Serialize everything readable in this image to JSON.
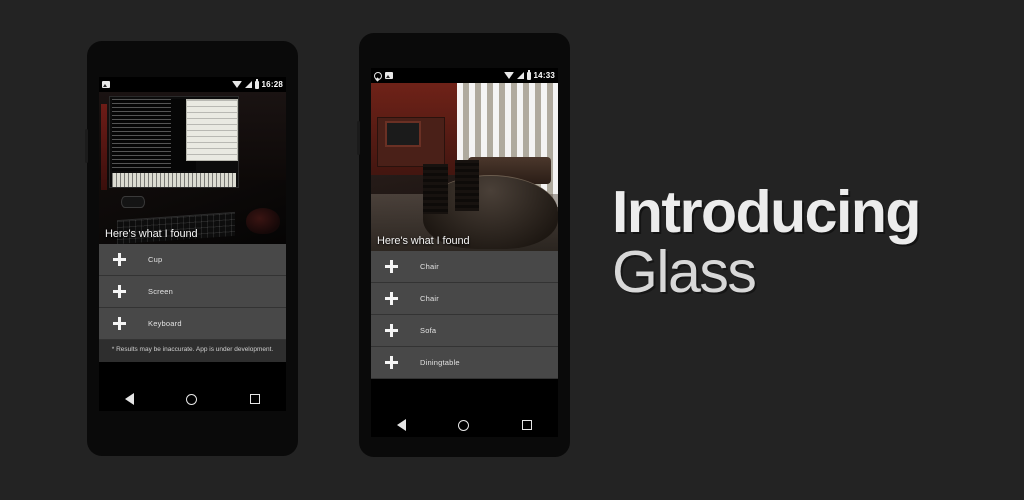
{
  "background_color": "#232323",
  "headline": {
    "line1": "Introducing",
    "line2": "Glass"
  },
  "phones": [
    {
      "id": "phone-left",
      "status_bar": {
        "time": "16:28",
        "left_icons": [
          "image-icon"
        ],
        "right_icons": [
          "wifi-icon",
          "signal-icon",
          "battery-icon"
        ]
      },
      "photo": {
        "caption": "Here's what I found",
        "description": "dark desk with monitor, keyboard and mouse"
      },
      "results": [
        {
          "label": "Cup",
          "action_icon": "plus-icon"
        },
        {
          "label": "Screen",
          "action_icon": "plus-icon"
        },
        {
          "label": "Keyboard",
          "action_icon": "plus-icon"
        }
      ],
      "disclaimer": "* Results may be inaccurate. App is under development.",
      "nav_bar": [
        "back-icon",
        "home-icon",
        "recents-icon"
      ]
    },
    {
      "id": "phone-right",
      "status_bar": {
        "time": "14:33",
        "left_icons": [
          "whatsapp-icon",
          "image-icon"
        ],
        "right_icons": [
          "wifi-icon",
          "signal-icon",
          "battery-icon"
        ]
      },
      "photo": {
        "caption": "Here's what I found",
        "description": "dining room with table, chairs, sofa and window"
      },
      "results": [
        {
          "label": "Chair",
          "action_icon": "plus-icon"
        },
        {
          "label": "Chair",
          "action_icon": "plus-icon"
        },
        {
          "label": "Sofa",
          "action_icon": "plus-icon"
        },
        {
          "label": "Diningtable",
          "action_icon": "plus-icon"
        }
      ],
      "disclaimer": "",
      "nav_bar": [
        "back-icon",
        "home-icon",
        "recents-icon"
      ]
    }
  ]
}
